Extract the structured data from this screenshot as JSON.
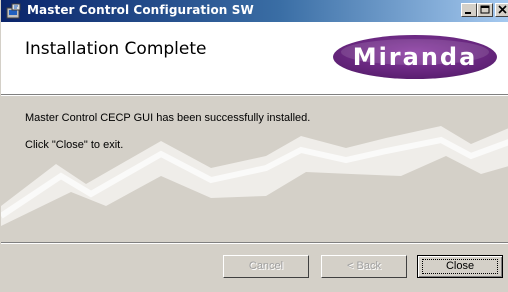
{
  "window": {
    "title": "Master Control Configuration SW",
    "controls": [
      "minimize-icon",
      "maximize-icon",
      "close-icon"
    ],
    "titlebar_colors": [
      "#0a246a",
      "#a6caf0"
    ]
  },
  "header": {
    "heading": "Installation Complete",
    "logo_text": "Miranda",
    "logo_color": "#6b2a82"
  },
  "content": {
    "line1": "Master Control CECP GUI has been successfully installed.",
    "line2": "Click \"Close\" to exit."
  },
  "buttons": {
    "cancel": {
      "label": "Cancel",
      "enabled": false
    },
    "back": {
      "label": "< Back",
      "enabled": false
    },
    "close": {
      "label": "Close",
      "enabled": true
    }
  }
}
